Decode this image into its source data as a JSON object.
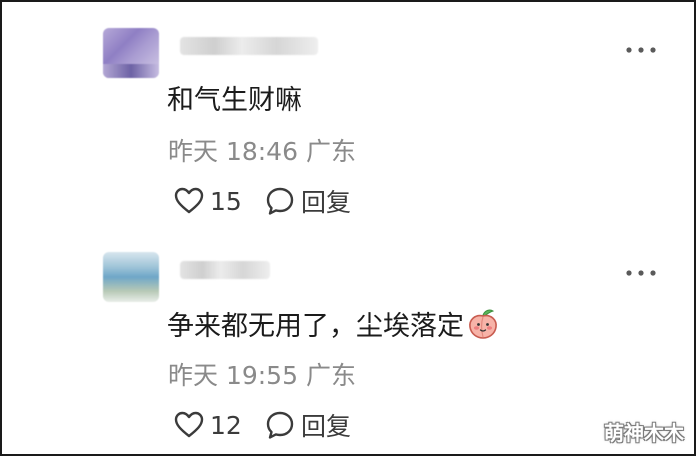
{
  "comments": [
    {
      "text": "和气生财嘛",
      "time": "昨天 18:46",
      "location": "广东",
      "likes": "15",
      "reply_label": "回复"
    },
    {
      "text": "争来都无用了，尘埃落定",
      "time": "昨天 19:55",
      "location": "广东",
      "likes": "12",
      "reply_label": "回复"
    }
  ],
  "icons": {
    "more": "more-icon",
    "like": "heart-icon",
    "reply": "speech-bubble-icon",
    "emoji": "peach-emoji-icon"
  },
  "colors": {
    "text": "#1b1b1b",
    "meta": "#8a8a8a",
    "action": "#3b3b3b"
  },
  "watermark": "萌神木木"
}
